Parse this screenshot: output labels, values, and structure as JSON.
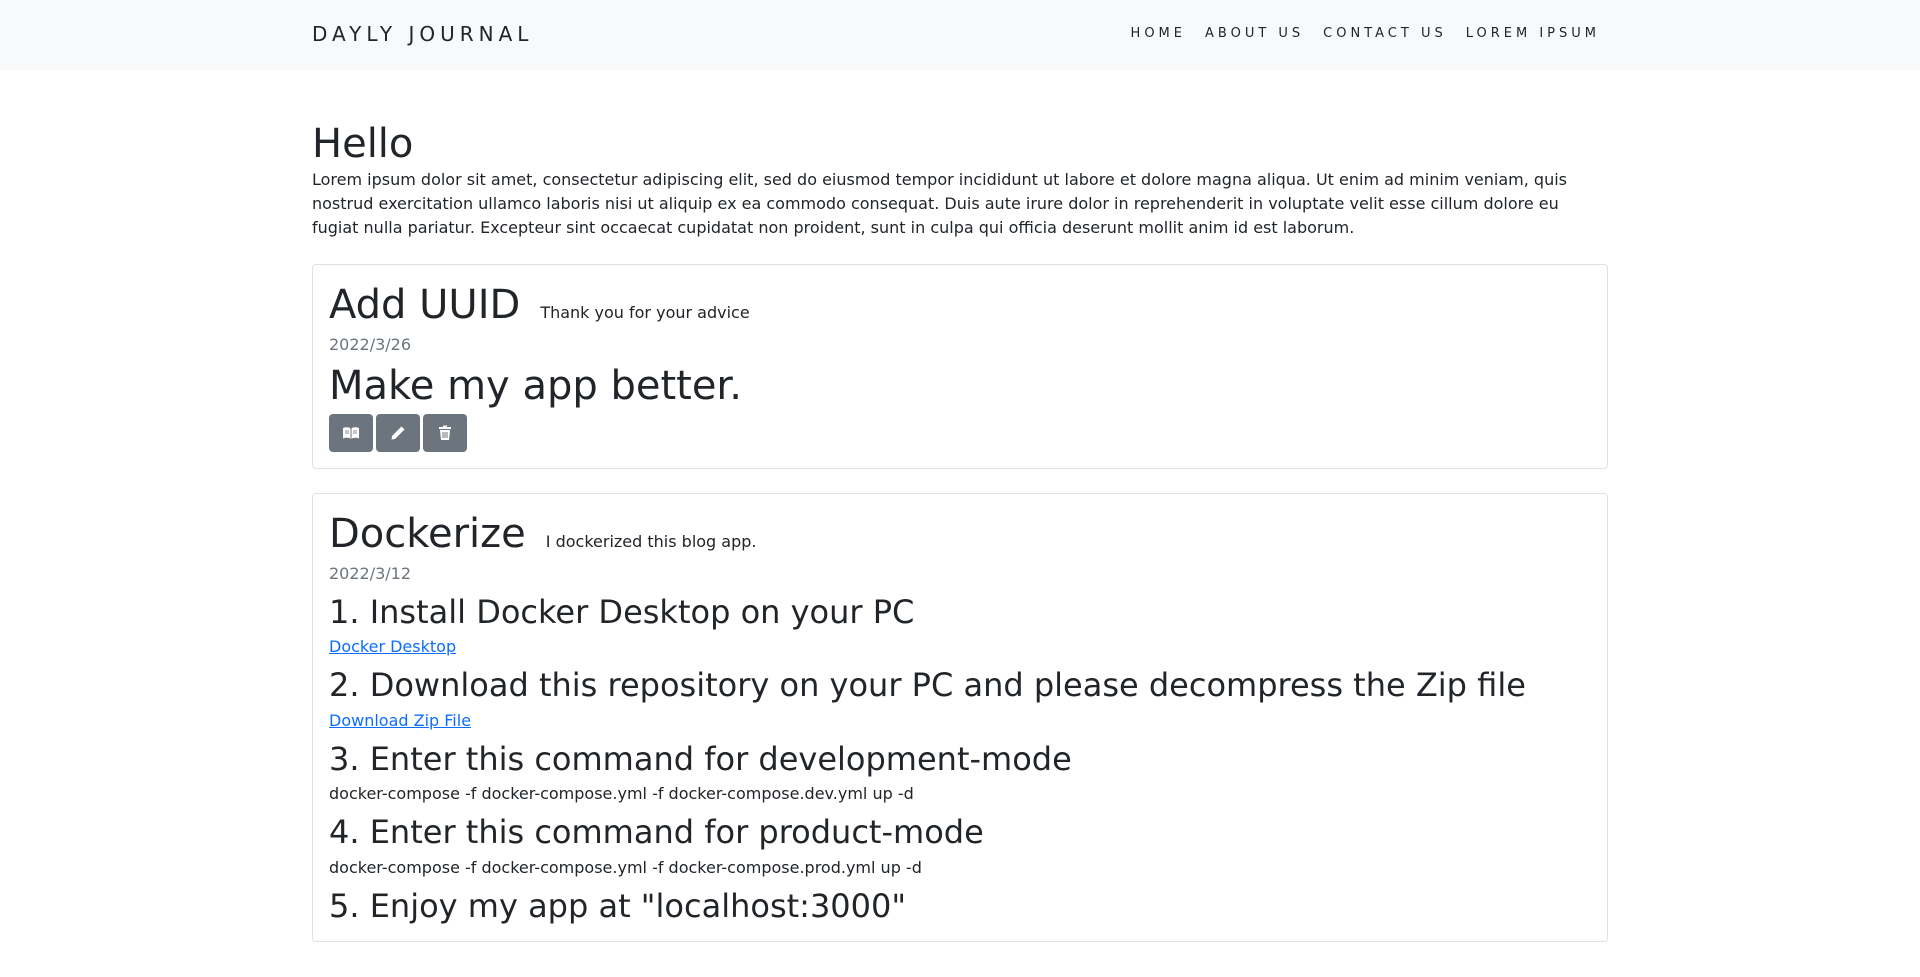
{
  "nav": {
    "brand": "DAYLY JOURNAL",
    "links": [
      "HOME",
      "ABOUT US",
      "CONTACT US",
      "LOREM IPSUM"
    ]
  },
  "intro": {
    "title": "Hello",
    "text": "Lorem ipsum dolor sit amet, consectetur adipiscing elit, sed do eiusmod tempor incididunt ut labore et dolore magna aliqua. Ut enim ad minim veniam, quis nostrud exercitation ullamco laboris nisi ut aliquip ex ea commodo consequat. Duis aute irure dolor in reprehenderit in voluptate velit esse cillum dolore eu fugiat nulla pariatur. Excepteur sint occaecat cupidatat non proident, sunt in culpa qui officia deserunt mollit anim id est laborum."
  },
  "posts": [
    {
      "title": "Add UUID",
      "subtitle": "Thank you for your advice",
      "date": "2022/3/26",
      "body": "Make my app better.",
      "actions": [
        "read-icon",
        "edit-icon",
        "delete-icon"
      ]
    },
    {
      "title": "Dockerize",
      "subtitle": "I dockerized this blog app.",
      "date": "2022/3/12",
      "steps": [
        {
          "title": "1. Install Docker Desktop on your PC",
          "link": "Docker Desktop"
        },
        {
          "title": "2. Download this repository on your PC and please decompress the Zip file",
          "link": "Download Zip File"
        },
        {
          "title": "3. Enter this command for development-mode",
          "cmd": "docker-compose -f docker-compose.yml -f docker-compose.dev.yml up -d"
        },
        {
          "title": "4. Enter this command for product-mode",
          "cmd": "docker-compose -f docker-compose.yml -f docker-compose.prod.yml up -d"
        },
        {
          "title": "5. Enjoy my app at \"localhost:3000\""
        }
      ]
    }
  ],
  "colors": {
    "navbar_bg": "#f8f9fa",
    "button_bg": "#6c757d",
    "link": "#0d6efd",
    "muted": "#6c757d"
  }
}
